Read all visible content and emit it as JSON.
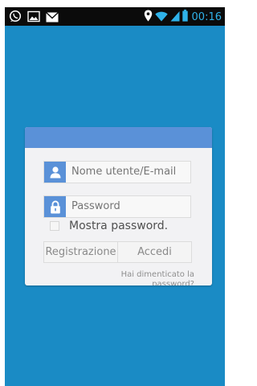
{
  "status_bar": {
    "time": "00:16",
    "left_icons": [
      "whatsapp-icon",
      "image-icon",
      "mail-icon"
    ],
    "right_icons": [
      "location-icon",
      "wifi-icon",
      "signal-icon",
      "battery-icon"
    ]
  },
  "login": {
    "username_placeholder": "Nome utente/E-mail",
    "password_placeholder": "Password",
    "show_password_label": "Mostra password.",
    "show_password_checked": false,
    "register_label": "Registrazione",
    "login_label": "Accedi",
    "forgot_label": "Hai dimenticato la password?"
  },
  "colors": {
    "background": "#1a8bc5",
    "accent": "#5a91d8",
    "time": "#2fb2e9"
  }
}
